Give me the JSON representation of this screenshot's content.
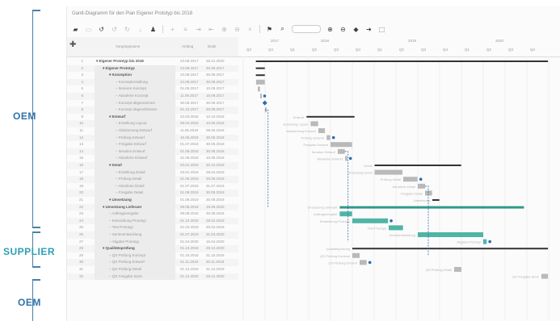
{
  "side_labels": {
    "oem_top": "OEM",
    "supplier": "SUPPLIER",
    "oem_bottom": "OEM",
    "colors": {
      "oem": "#2f72a8",
      "supplier": "#2d9fb3",
      "brace": "#4a7fa6"
    }
  },
  "app": {
    "window_title": "Gantt-Diagramm für den Plan Eigener Prototyp bis 2018",
    "toolbar_icons": [
      "folder-icon",
      "save-icon",
      "undo-icon",
      "undo-dim-icon",
      "redo-dim-icon",
      "arrow-dim-icon",
      "user-icon",
      "add-icon",
      "list-icon",
      "indent-icon",
      "outdent-icon",
      "link-icon",
      "unlink-icon",
      "close-icon",
      "flag-icon",
      "search-icon",
      "zoom-in-icon",
      "zoom-out-icon",
      "diamond-icon",
      "arrow-right-icon",
      "expand-icon"
    ]
  },
  "grid": {
    "columns": {
      "name": "Vorgangsname",
      "start": "Anfang",
      "end": "Ende"
    },
    "rows": [
      {
        "num": "1",
        "name": "Eigener Prototyp bis 2018",
        "start": "23.08.2017",
        "end": "28.12.2020",
        "indent": 0,
        "bold": true
      },
      {
        "num": "2",
        "name": "Eigener Prototyp",
        "start": "23.08.2017",
        "end": "30.09.2017",
        "indent": 1,
        "bold": true
      },
      {
        "num": "3",
        "name": "Konzeption",
        "start": "23.08.2017",
        "end": "30.09.2017",
        "indent": 2,
        "bold": true
      },
      {
        "num": "4",
        "name": "Konzepterstellung",
        "start": "24.08.2017",
        "end": "30.09.2017",
        "indent": 3,
        "bold": false
      },
      {
        "num": "5",
        "name": "Iterieren Konzept",
        "start": "01.09.2017",
        "end": "10.09.2017",
        "indent": 3,
        "bold": false
      },
      {
        "num": "6",
        "name": "Abnahme Konzept",
        "start": "11.09.2017",
        "end": "16.09.2017",
        "indent": 3,
        "bold": false
      },
      {
        "num": "7",
        "name": "Konzept abgenommen",
        "start": "30.09.2017",
        "end": "30.09.2017",
        "indent": 3,
        "bold": false
      },
      {
        "num": "8",
        "name": "Konzept abgeschlossen",
        "start": "01.10.2017",
        "end": "30.09.2017",
        "indent": 3,
        "bold": false
      },
      {
        "num": "9",
        "name": "Entwurf",
        "start": "22.03.2018",
        "end": "10.10.2018",
        "indent": 2,
        "bold": true
      },
      {
        "num": "10",
        "name": "Erstellung Layout",
        "start": "09.04.2018",
        "end": "10.05.2018",
        "indent": 3,
        "bold": false
      },
      {
        "num": "11",
        "name": "Abstimmung Entwurf",
        "start": "11.05.2018",
        "end": "08.06.2018",
        "indent": 3,
        "bold": false
      },
      {
        "num": "12",
        "name": "Prüfung Entwurf",
        "start": "15.06.2018",
        "end": "30.06.2018",
        "indent": 3,
        "bold": false
      },
      {
        "num": "13",
        "name": "Freigabe Entwurf",
        "start": "01.07.2018",
        "end": "30.09.2018",
        "indent": 3,
        "bold": false
      },
      {
        "num": "14",
        "name": "Iteration Entwurf",
        "start": "01.08.2018",
        "end": "30.08.2018",
        "indent": 3,
        "bold": false
      },
      {
        "num": "15",
        "name": "Abnahme Entwurf",
        "start": "31.08.2018",
        "end": "10.09.2018",
        "indent": 3,
        "bold": false
      },
      {
        "num": "16",
        "name": "Detail",
        "start": "03.01.2019",
        "end": "30.12.2019",
        "indent": 2,
        "bold": true
      },
      {
        "num": "17",
        "name": "Erstellung Detail",
        "start": "03.01.2019",
        "end": "28.04.2019",
        "indent": 3,
        "bold": false
      },
      {
        "num": "18",
        "name": "Prüfung Detail",
        "start": "01.05.2019",
        "end": "30.06.2019",
        "indent": 3,
        "bold": false
      },
      {
        "num": "19",
        "name": "Abnahme Detail",
        "start": "01.07.2019",
        "end": "31.07.2019",
        "indent": 3,
        "bold": false
      },
      {
        "num": "20",
        "name": "Freigabe Detail",
        "start": "01.08.2019",
        "end": "30.08.2019",
        "indent": 3,
        "bold": false
      },
      {
        "num": "21",
        "name": "Umsetzung",
        "start": "01.09.2019",
        "end": "30.09.2019",
        "indent": 2,
        "bold": true
      },
      {
        "num": "22",
        "name": "Umsetzung Lieferant",
        "start": "09.08.2018",
        "end": "19.09.2020",
        "indent": 1,
        "bold": true
      },
      {
        "num": "23",
        "name": "Auftragsvergabe",
        "start": "09.08.2018",
        "end": "30.09.2018",
        "indent": 2,
        "bold": false
      },
      {
        "num": "24",
        "name": "Entwicklung Prototyp",
        "start": "01.10.2018",
        "end": "28.02.2019",
        "indent": 2,
        "bold": false
      },
      {
        "num": "25",
        "name": "Test Prototyp",
        "start": "01.03.2019",
        "end": "30.04.2019",
        "indent": 2,
        "bold": false
      },
      {
        "num": "26",
        "name": "Serienentwicklung",
        "start": "01.07.2019",
        "end": "31.03.2020",
        "indent": 2,
        "bold": false
      },
      {
        "num": "27",
        "name": "Abgabe Prototyp",
        "start": "01.04.2020",
        "end": "15.04.2020",
        "indent": 2,
        "bold": false
      },
      {
        "num": "28",
        "name": "Qualitätsprüfung",
        "start": "01.10.2018",
        "end": "28.12.2020",
        "indent": 1,
        "bold": true
      },
      {
        "num": "29",
        "name": "QS Prüfung Konzept",
        "start": "01.10.2018",
        "end": "31.10.2018",
        "indent": 2,
        "bold": false
      },
      {
        "num": "30",
        "name": "QS Prüfung Entwurf",
        "start": "01.11.2018",
        "end": "30.11.2018",
        "indent": 2,
        "bold": false
      },
      {
        "num": "31",
        "name": "QS Prüfung Detail",
        "start": "01.12.2019",
        "end": "31.12.2019",
        "indent": 2,
        "bold": false
      },
      {
        "num": "32",
        "name": "QS Freigabe Serie",
        "start": "01.12.2020",
        "end": "28.12.2020",
        "indent": 2,
        "bold": false
      }
    ]
  },
  "timeline": {
    "years": [
      "2017",
      "2018",
      "2019",
      "2020"
    ],
    "quarters": [
      "Q3",
      "Q4",
      "Q1",
      "Q2",
      "Q3",
      "Q4",
      "Q1",
      "Q2",
      "Q3",
      "Q4",
      "Q1",
      "Q2",
      "Q3",
      "Q4"
    ],
    "colors": {
      "bar": "#b9b9b9",
      "supplier_bar": "#4fb5a6",
      "summary": "#333333",
      "milestone": "#2a6bb0",
      "dependency": "#2a6bb0"
    }
  }
}
